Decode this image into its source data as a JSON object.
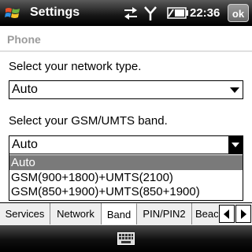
{
  "titlebar": {
    "title": "Settings",
    "time": "22:36",
    "ok_label": "ok",
    "icons": [
      "windows-start-icon",
      "sync-icon",
      "signal-icon",
      "battery-icon"
    ]
  },
  "page": {
    "heading": "Phone"
  },
  "network": {
    "label": "Select your network type.",
    "value": "Auto"
  },
  "band": {
    "label": "Select your GSM/UMTS band.",
    "value": "Auto",
    "options": [
      "Auto",
      "GSM(900+1800)+UMTS(2100)",
      "GSM(850+1900)+UMTS(850+1900)"
    ],
    "selected_index": 0
  },
  "tabs": [
    {
      "label": "Services",
      "active": false
    },
    {
      "label": "Network",
      "active": false
    },
    {
      "label": "Band",
      "active": true
    },
    {
      "label": "PIN/PIN2",
      "active": false
    },
    {
      "label": "Beacon",
      "active": false
    }
  ],
  "bottombar": {
    "icon": "keyboard-icon"
  },
  "colors": {
    "titlebar": "#000000",
    "selected_option": "#7a7a7a",
    "heading": "#9b9b9b"
  }
}
